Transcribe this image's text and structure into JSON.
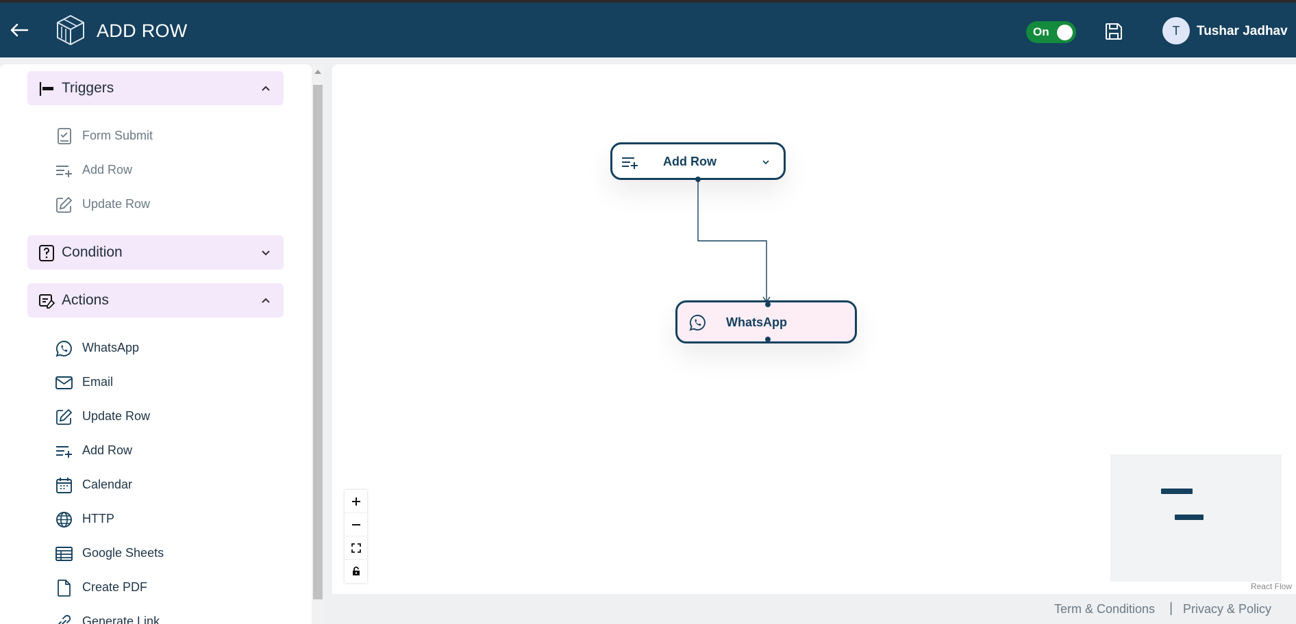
{
  "header": {
    "title": "ADD ROW",
    "toggle_label": "On",
    "avatar_initial": "T",
    "user_name": "Tushar Jadhav",
    "icons": [
      "back-arrow-icon",
      "cube-logo-icon",
      "save-icon"
    ]
  },
  "sidebar": {
    "sections": [
      {
        "title": "Triggers",
        "icon": "trigger-icon",
        "expanded": true,
        "items": [
          {
            "label": "Form Submit",
            "icon": "form-icon"
          },
          {
            "label": "Add Row",
            "icon": "add-row-icon"
          },
          {
            "label": "Update Row",
            "icon": "edit-icon"
          }
        ]
      },
      {
        "title": "Condition",
        "icon": "question-icon",
        "expanded": false,
        "items": []
      },
      {
        "title": "Actions",
        "icon": "action-icon",
        "expanded": true,
        "items": [
          {
            "label": "WhatsApp",
            "icon": "whatsapp-icon"
          },
          {
            "label": "Email",
            "icon": "mail-icon"
          },
          {
            "label": "Update Row",
            "icon": "edit-icon"
          },
          {
            "label": "Add Row",
            "icon": "add-row-icon"
          },
          {
            "label": "Calendar",
            "icon": "calendar-icon"
          },
          {
            "label": "HTTP",
            "icon": "globe-icon"
          },
          {
            "label": "Google Sheets",
            "icon": "table-icon"
          },
          {
            "label": "Create PDF",
            "icon": "file-icon"
          },
          {
            "label": "Generate Link",
            "icon": "link-icon"
          }
        ]
      }
    ]
  },
  "canvas": {
    "nodes": [
      {
        "label": "Add Row",
        "icon": "add-row-icon",
        "type": "trigger"
      },
      {
        "label": "WhatsApp",
        "icon": "whatsapp-icon",
        "type": "action"
      }
    ],
    "controls": [
      "zoom-in",
      "zoom-out",
      "fit-view",
      "lock"
    ],
    "attribution": "React Flow"
  },
  "footer": {
    "terms": "Term & Conditions",
    "separator": "|",
    "privacy": "Privacy & Policy"
  },
  "colors": {
    "header_bg": "#15405e",
    "toggle_on": "#138a3c",
    "section_bg": "#f4e8fb",
    "whatsapp_node_bg": "#fdeef6"
  }
}
